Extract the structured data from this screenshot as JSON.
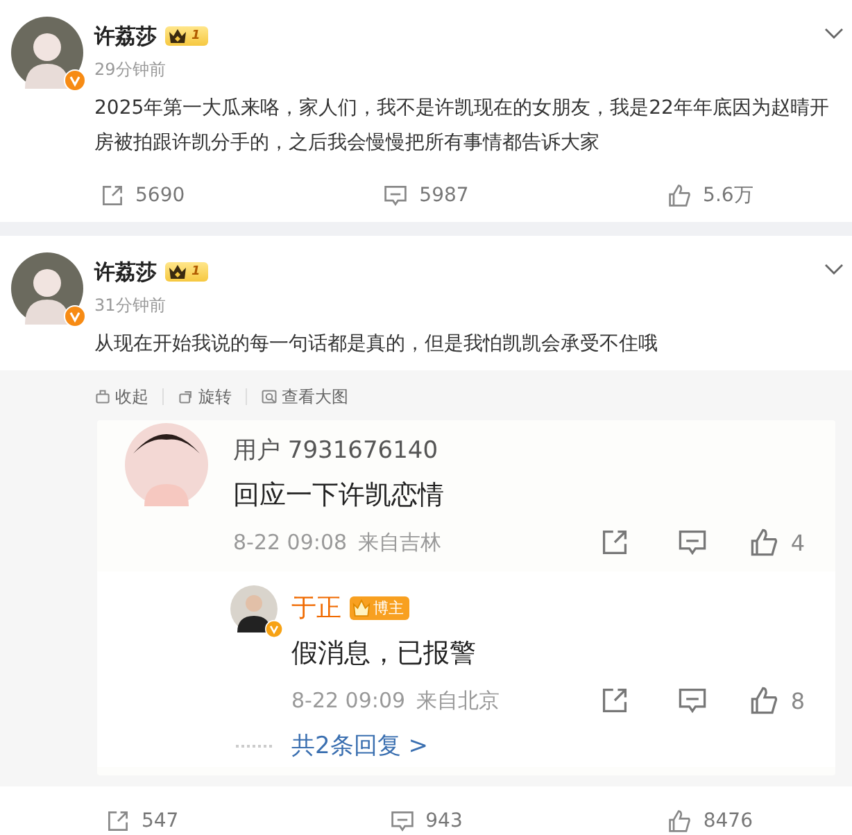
{
  "posts": [
    {
      "author": "许荔莎",
      "level": "1",
      "time": "29分钟前",
      "text": "2025年第一大瓜来咯，家人们，我不是许凯现在的女朋友，我是22年年底因为赵晴开房被拍跟许凯分手的，之后我会慢慢把所有事情都告诉大家",
      "actions": {
        "reposts": "5690",
        "comments": "5987",
        "likes": "5.6万"
      }
    },
    {
      "author": "许荔莎",
      "level": "1",
      "time": "31分钟前",
      "text": "从现在开始我说的每一句话都是真的，但是我怕凯凯会承受不住哦",
      "media": {
        "toolbar": [
          {
            "kind": "collapse",
            "label": "收起"
          },
          {
            "kind": "rotate",
            "label": "旋转"
          },
          {
            "kind": "enlarge",
            "label": "查看大图"
          }
        ],
        "comment": {
          "user": "用户 7931676140",
          "text": "回应一下许凯恋情",
          "time": "8-22 09:08",
          "location": "来自吉林",
          "likes": "4",
          "reply": {
            "user": "于正",
            "badge": "博主",
            "text": "假消息，已报警",
            "time": "8-22 09:09",
            "location": "来自北京",
            "likes": "8"
          },
          "more_replies": "共2条回复 >"
        }
      },
      "actions": {
        "reposts": "547",
        "comments": "943",
        "likes": "8476"
      }
    }
  ]
}
